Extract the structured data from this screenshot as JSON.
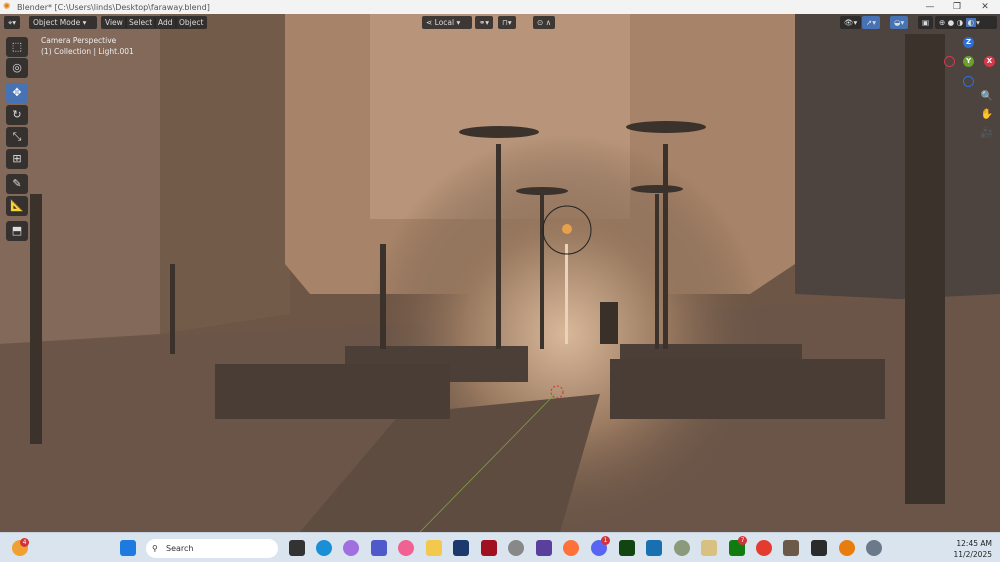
{
  "window": {
    "title": "Blender* [C:\\Users\\linds\\Desktop\\faraway.blend]",
    "minimize": "—",
    "maximize": "❐",
    "close": "✕"
  },
  "header": {
    "mode": "Object Mode",
    "menus": [
      "View",
      "Select",
      "Add",
      "Object"
    ],
    "transform_orientation": "Local"
  },
  "overlay_info": {
    "view": "Camera Perspective",
    "collection": "(1) Collection | Light.001"
  },
  "gizmo": {
    "z": "Z",
    "x": "X",
    "y": "Y"
  },
  "taskbar": {
    "search_placeholder": "Search",
    "weather_badge": "4",
    "discord_badge": "1",
    "xbox_badge": "7",
    "time": "12:45 AM",
    "date": "11/2/2025"
  },
  "colors": {
    "accent": "#4772b3",
    "viewport": "#6b5444",
    "taskbar": "#d9e4ee"
  }
}
